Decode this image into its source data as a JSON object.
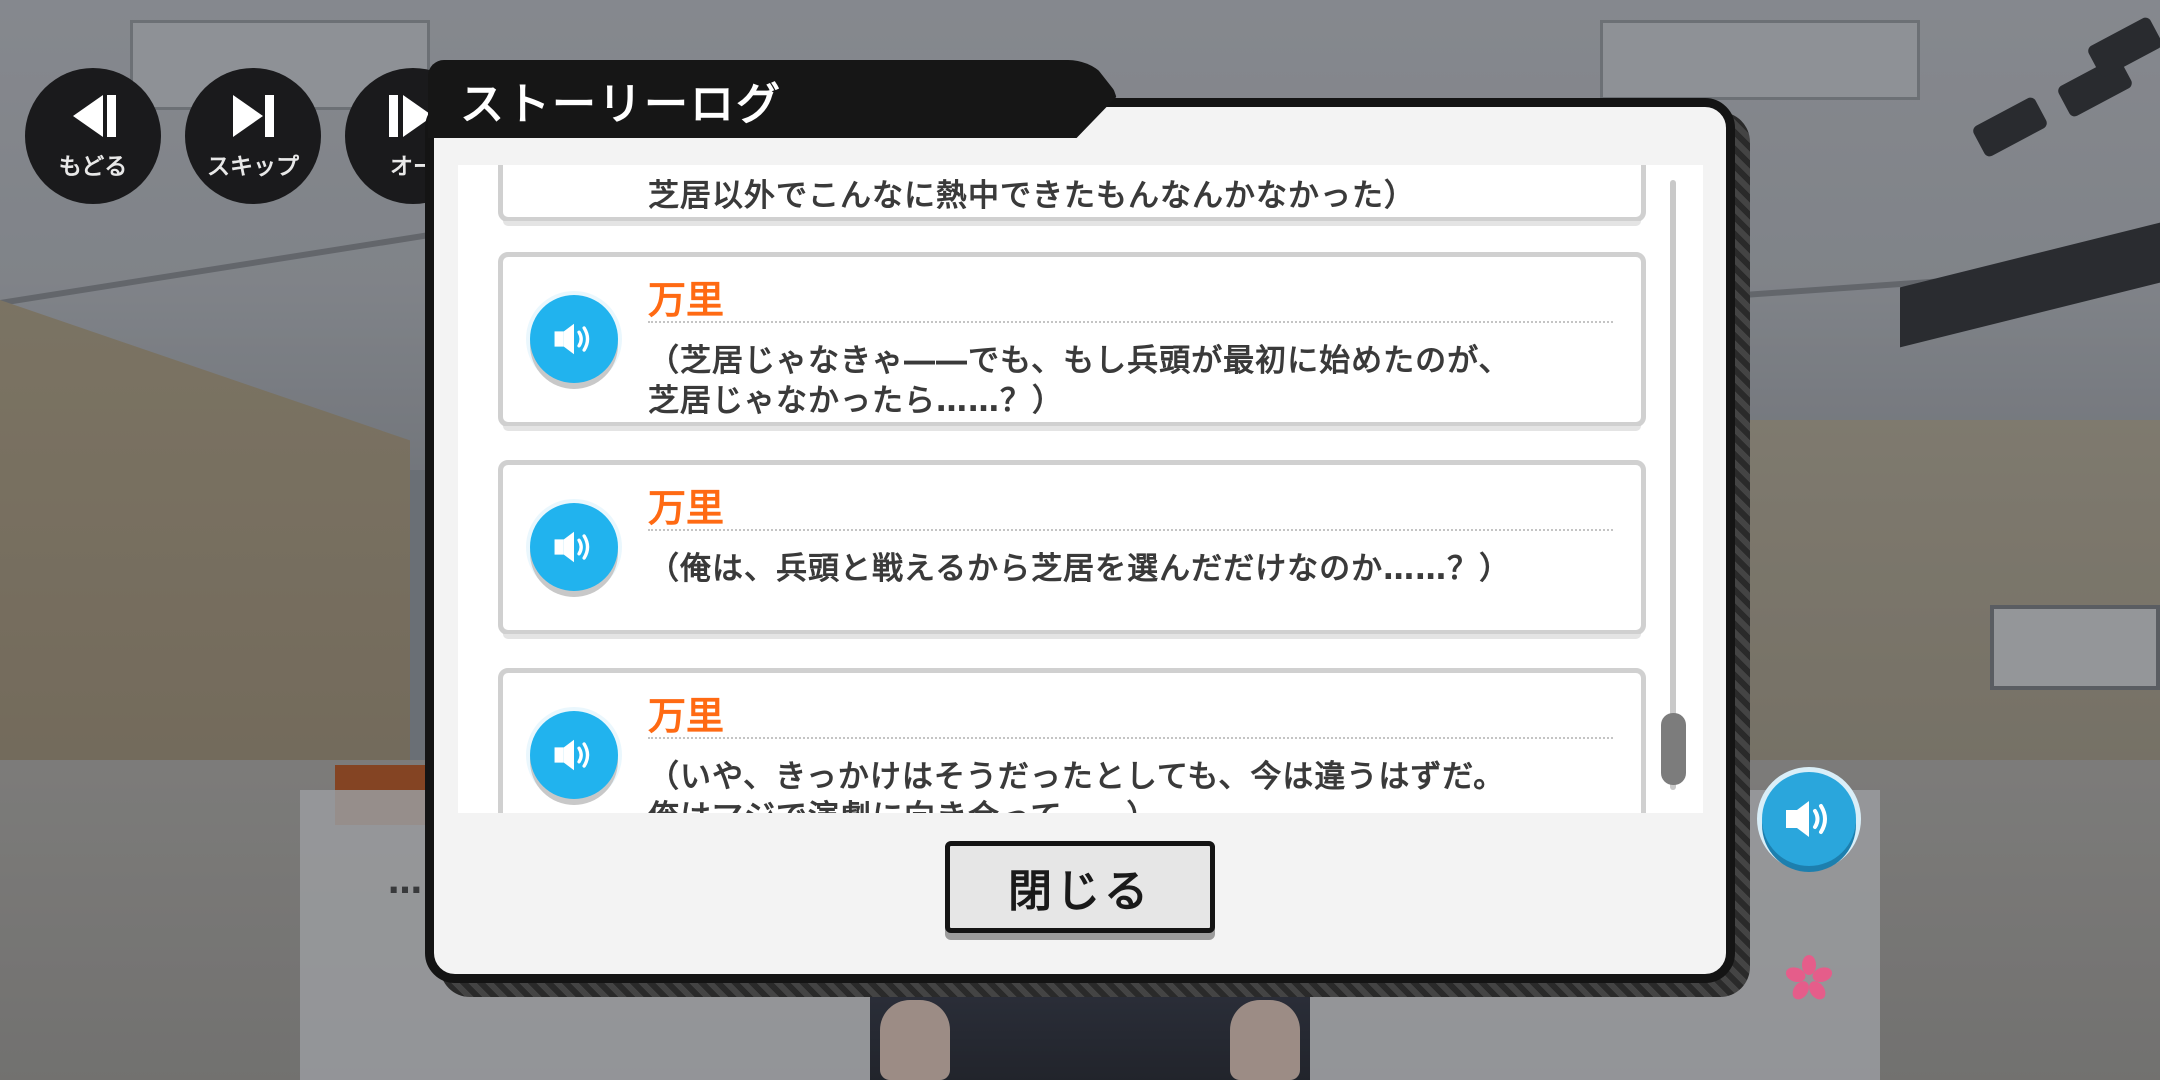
{
  "controls": [
    {
      "label": "もどる",
      "icon": "rewind-icon"
    },
    {
      "label": "スキップ",
      "icon": "skip-icon"
    },
    {
      "label": "オー",
      "icon": "auto-icon"
    }
  ],
  "textbox": {
    "text": "…"
  },
  "modal": {
    "title": "ストーリーログ",
    "close_label": "閉じる",
    "entries": [
      {
        "speaker": "",
        "lines": [
          "芝居以外でこんなに熱中できたもんなんかなかった）"
        ]
      },
      {
        "speaker": "万里",
        "lines": [
          "（芝居じゃなきゃ――でも、もし兵頭が最初に始めたのが、",
          "芝居じゃなかったら……？）"
        ]
      },
      {
        "speaker": "万里",
        "lines": [
          "（俺は、兵頭と戦えるから芝居を選んだだけなのか……？）"
        ]
      },
      {
        "speaker": "万里",
        "lines": [
          "（いや、きっかけはそうだったとしても、今は違うはずだ。",
          "俺はマジで演劇に向き合って――）"
        ]
      }
    ]
  },
  "colors": {
    "speaker": "#ff6a13",
    "voice_button": "#21b3ee",
    "modal_border": "#141414"
  }
}
